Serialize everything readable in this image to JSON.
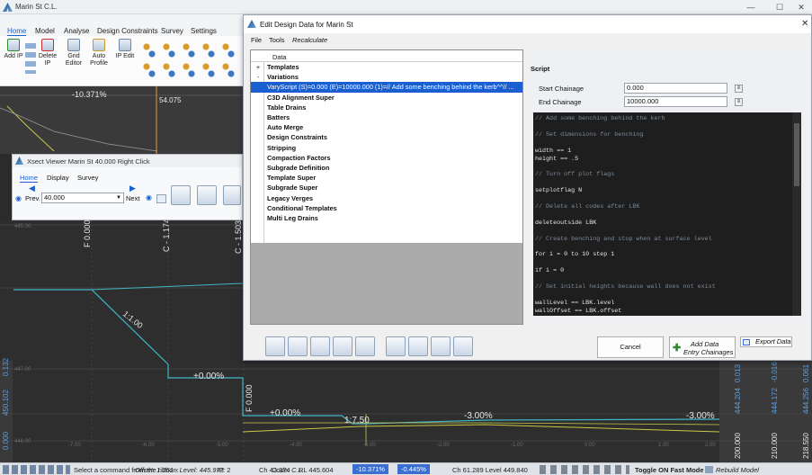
{
  "app": {
    "title": "Marin St C.L.",
    "window_controls": [
      "—",
      "☐",
      "✕"
    ],
    "tabs": [
      "Home",
      "Model",
      "Analyse",
      "Design Constraints",
      "Survey",
      "Settings"
    ],
    "ribbon": {
      "add_ip": "Add IP",
      "delete_ip": "Delete IP",
      "grid_editor": "Grid Editor",
      "auto_profile": "Auto Profile",
      "ip_edit": "IP Edit"
    }
  },
  "profile_view": {
    "grade": "-10.371%",
    "chainage_label": "54.075"
  },
  "xsect_viewer": {
    "title": "Xsect Viewer Marin St  40.000  Right Click",
    "tabs": [
      "Home",
      "Display",
      "Survey"
    ],
    "prev_label": "Prev.",
    "next_label": "Next",
    "chainage_value": "40.000"
  },
  "section_view": {
    "string_labels": [
      "F 0.000",
      "C - 1.174",
      "C - 1.503",
      "F 0.000"
    ],
    "slope_label": "1:1.00",
    "grade_1": "+0.00%",
    "grade_2": "+0.00%",
    "bench_slope": "1:7.50",
    "grade_3": "-3.00%",
    "grade_4": "-3.00%",
    "left_axis": [
      "450.102",
      "0.132",
      "0.000"
    ],
    "left_axis_small": [
      "445.00",
      "447.00",
      "446.00"
    ],
    "right_axis": [
      {
        "level": "444.204",
        "offset": "0.013",
        "chainage": "200.000"
      },
      {
        "level": "444.172",
        "offset": "-0.016",
        "chainage": "210.000"
      },
      {
        "level": "444.256",
        "offset": "0.061",
        "chainage": "218.550"
      }
    ],
    "bottom_ticks": [
      "-7.00",
      "-6.00",
      "-5.00",
      "-4.00",
      "-3.00",
      "-2.00",
      "-1.00",
      "0.00",
      "1.00",
      "2.00"
    ]
  },
  "status": {
    "prompt": "Select a command from the ribbon:",
    "offset_level": "Offset: 1.261 - Level: 445.973",
    "code": "Code: C.L.",
    "ip": "IP: 2",
    "ch": "Ch 43.374",
    "rl": "RL 445.604",
    "grade_a": "-10.371%",
    "grade_b": "-0.445%",
    "ch_level": "Ch 61.289 Level 449.840",
    "toggle": "Toggle ON Fast Mode",
    "rebuild": "Rebuild Model"
  },
  "dialog": {
    "title": "Edit Design Data for Marin St",
    "menu": [
      "File",
      "Tools",
      "Recalculate"
    ],
    "tree_header": "Data",
    "tree_items": [
      {
        "pm": "+",
        "label": "Templates",
        "bold": true
      },
      {
        "pm": "-",
        "label": "Variations",
        "bold": true
      },
      {
        "pm": "",
        "label": "VaryScript (S)=0.000  (E)=10000.000  (1)=// Add some benching behind the kerb^^// ...",
        "bold": false,
        "selected": true
      },
      {
        "pm": "",
        "label": "C3D Alignment Super",
        "bold": true
      },
      {
        "pm": "",
        "label": "Table Drains",
        "bold": true
      },
      {
        "pm": "",
        "label": "Batters",
        "bold": true
      },
      {
        "pm": "",
        "label": "Auto Merge",
        "bold": true
      },
      {
        "pm": "",
        "label": "Design Constraints",
        "bold": true
      },
      {
        "pm": "",
        "label": "Stripping",
        "bold": true
      },
      {
        "pm": "",
        "label": "Compaction Factors",
        "bold": true
      },
      {
        "pm": "",
        "label": "Subgrade Definition",
        "bold": true
      },
      {
        "pm": "",
        "label": "Template Super",
        "bold": true
      },
      {
        "pm": "",
        "label": "Subgrade Super",
        "bold": true
      },
      {
        "pm": "",
        "label": "Legacy Verges",
        "bold": true
      },
      {
        "pm": "",
        "label": "Conditional Templates",
        "bold": true
      },
      {
        "pm": "",
        "label": "Multi Leg Drains",
        "bold": true
      }
    ],
    "script_group": "Script",
    "start_chainage_label": "Start Chainage",
    "start_chainage_value": "0.000",
    "end_chainage_label": "End Chainage",
    "end_chainage_value": "10000.000",
    "script_lines": [
      "// Add some benching behind the kerb",
      "",
      "// Set dimensions for benching",
      "",
      "width == 1",
      "height == .5",
      "",
      "// Turn off plot flags",
      "",
      "setplotflag N",
      "",
      "// Delete all codes after LBK",
      "",
      "deleteoutside LBK",
      "",
      "// Create benching and stop when at surface level",
      "",
      "for i = 0 to 10 step 1",
      "",
      "if i = 0",
      "",
      "// Set initial heights because wall does not exist",
      "",
      "wallLevel == LBK.level",
      "wallOffset == LBK.offset"
    ],
    "cancel_label": "Cancel",
    "add_data_label": "Add Data",
    "entry_chainages_label": "Entry Chainages",
    "export_data_label": "Export Data"
  },
  "colors": {
    "dialog_select": "#1a5fd0",
    "design_line": "#3fb6c6",
    "ground_line": "#c8c84a",
    "grade_badge": "#3a6fd0",
    "axis_text": "#5f9fe0"
  }
}
